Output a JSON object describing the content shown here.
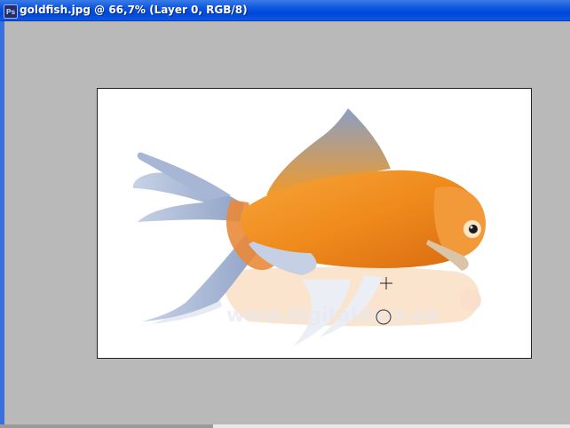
{
  "window": {
    "title": "goldfish.jpg @ 66,7% (Layer 0, RGB/8)",
    "app_icon": "ps-document-icon",
    "app_icon_label": "Ps"
  },
  "canvas": {
    "watermark": "www.digitalders.co",
    "background": "#ffffff",
    "workspace_color": "#b9b9b9",
    "cursor": "crosshair-icon",
    "brush": "brush-circle-icon"
  },
  "colors": {
    "titlebar": "#0a54df",
    "fish_orange": "#f08a1a",
    "fin_blue": "#9fb0d0"
  }
}
